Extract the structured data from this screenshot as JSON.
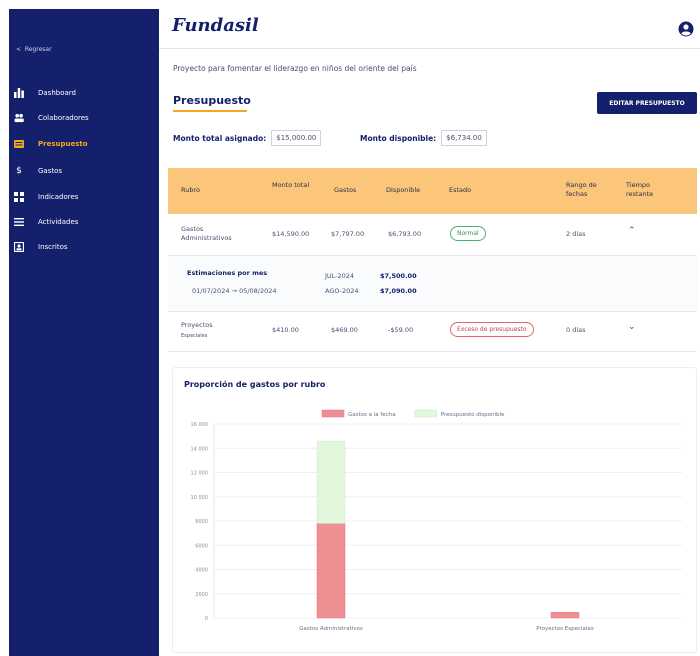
{
  "sidebar": {
    "back_label": "Regresar",
    "items": [
      {
        "label": "Dashboard",
        "icon": "chart-bars-icon",
        "active": false
      },
      {
        "label": "Colaboradores",
        "icon": "users-icon",
        "active": false
      },
      {
        "label": "Presupuesto",
        "icon": "wallet-icon",
        "active": true
      },
      {
        "label": "Gastos",
        "icon": "dollar-icon",
        "active": false
      },
      {
        "label": "Indicadores",
        "icon": "grid-icon",
        "active": false
      },
      {
        "label": "Actividades",
        "icon": "list-icon",
        "active": false
      },
      {
        "label": "Inscritos",
        "icon": "id-card-icon",
        "active": false
      }
    ]
  },
  "header": {
    "logo": "Fundasil",
    "user_icon": "user-circle-icon"
  },
  "project_name": "Proyecto para fomentar el liderazgo en niños del oriente del país",
  "section": {
    "title": "Presupuesto",
    "edit_button": "EDITAR PRESUPUESTO"
  },
  "amounts": {
    "total_label": "Monto total asignado:",
    "total_value": "$15,000.00",
    "available_label": "Monto disponible:",
    "available_value": "$6,734.00"
  },
  "table": {
    "headers": {
      "rubro": "Rubro",
      "monto": "Monto total",
      "gastos": "Gastos",
      "disponible": "Disponible",
      "estado": "Estado",
      "rango": "Rango de fechas",
      "tiempo": "Tiempo restante"
    },
    "rows": [
      {
        "rubro": "Gastos Administrativos",
        "monto": "$14,590.00",
        "gastos": "$7,797.00",
        "disponible": "$6,793.00",
        "estado": "Normal",
        "tiempo": "2 días"
      },
      {
        "rubro": "Proyectos",
        "rubro_sub": "Especiales",
        "monto": "$410.00",
        "gastos": "$469.00",
        "disponible": "-$59.00",
        "estado": "Exceso de presupuesto",
        "tiempo": "0 días"
      }
    ],
    "sub": {
      "title": "Estimaciones por mes",
      "range_start": "01/07/2024",
      "range_end": "05/08/2024",
      "months": [
        {
          "month": "JUL-2024",
          "amount": "$7,500.00"
        },
        {
          "month": "AGO-2024",
          "amount": "$7,090.00"
        }
      ]
    }
  },
  "chart_data": {
    "type": "bar",
    "title": "Proporción de gastos por rubro",
    "stacked": true,
    "categories": [
      "Gastos Administrativos",
      "Proyectos Especiales"
    ],
    "series": [
      {
        "name": "Gastos a la fecha",
        "values": [
          7797,
          469
        ],
        "color": "#ee8f93"
      },
      {
        "name": "Presupuesto disponible",
        "values": [
          6793,
          0
        ],
        "color": "#e3f7dc"
      }
    ],
    "ylim": [
      0,
      16000
    ],
    "yticks": [
      "0",
      "2000",
      "4000",
      "6000",
      "8000",
      "10 000",
      "12 000",
      "14 000",
      "16 000"
    ],
    "grid": true,
    "legend": "top"
  }
}
